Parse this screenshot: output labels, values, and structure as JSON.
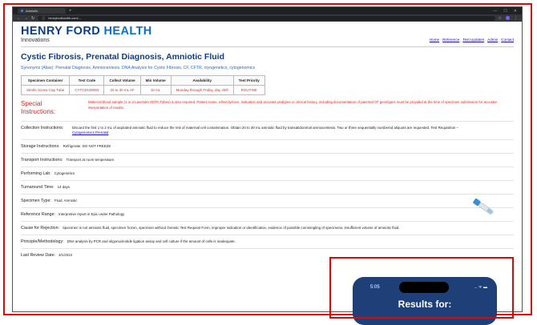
{
  "browser": {
    "tab_title": "Amniotic",
    "url": "henryfordhealth.com/...",
    "win_buttons": [
      "—",
      "☐",
      "✕"
    ]
  },
  "site": {
    "logo_main": "HENRY FORD",
    "logo_health": "HEALTH",
    "logo_sub": "Innovations",
    "links": [
      "Home",
      "Reference",
      "Test Updates",
      "Admin",
      "Contact"
    ]
  },
  "page_title": "Cystic Fibrosis, Prenatal Diagnosis, Amniotic Fluid",
  "synonyms": "Synonyms (Alias): Prenatal Diagnosis, Amniocentesis, DNA Analysis for Cystic Fibrosis, CF, CFTR, ctyogenetics, cytogenomics",
  "spec_table": {
    "headers": [
      "Specimen Container",
      "Test Code",
      "Collect Volume",
      "Min Volume",
      "Availability",
      "Test Priority"
    ],
    "row": [
      "Sterile Screw Cap Tube",
      "CYTOZ100003",
      "20 to 30 mL AF",
      "10 mL",
      "Monday through Friday, day shift",
      "ROUTINE"
    ]
  },
  "special": {
    "label": "Special Instructions:",
    "text": "Maternal blood sample (1 or 2 Lavender EDTA Tubes) is also required. Patient name, ethnicity/race, indication and accurate pedigree or clinical history, including documentation of parental CF genotypes must be provided at the time of specimen submission for accurate interpretation of results."
  },
  "fields": {
    "collection_label": "Collection Instructions:",
    "collection_text": "Discard the first 1 to 2 mL of aspirated amniotic fluid to reduce the risk of maternal cell contamination. Obtain 20 to 30 mL amniotic fluid by transabdominal amniocentesis. Two or three sequentially numbered aliquots are requested. Test Requisition –",
    "collection_link": "Cytogenomics Prenatal",
    "storage_label": "Storage Instructions:",
    "storage_text": "Refrigerate. DO NOT FREEZE",
    "transport_label": "Transport Instructions:",
    "transport_text": "Transport at room temperature.",
    "lab_label": "Performing Lab:",
    "lab_text": "Cytogenetics",
    "tat_label": "Turnaround Time:",
    "tat_text": "14 days",
    "type_label": "Specimen Type:",
    "type_text": "Fluid, Amniotic",
    "ref_label": "Reference Range:",
    "ref_text": "Interpretive report in Epic under Pathology",
    "reject_label": "Cause for Rejection:",
    "reject_text": "Specimen is not amniotic fluid, specimen frozen, specimen without Genetic Test Request Form, improper indication or identification, evidence of possible commingling of specimens, insufficient volume of amniotic fluid.",
    "method_label": "Principle/Methodology:",
    "method_text": "DNA analysis by PCR and oligonucleotide ligation assay and cell culture if the amount of cells is inadequate.",
    "review_label": "Last Review Date:",
    "review_text": "3/1/2024"
  },
  "phone": {
    "time": "5:05",
    "status": "... ᯤ ▬",
    "title": "Results for:"
  },
  "colors": {
    "brand_blue": "#0a3f86",
    "accent_red": "#e10600"
  }
}
